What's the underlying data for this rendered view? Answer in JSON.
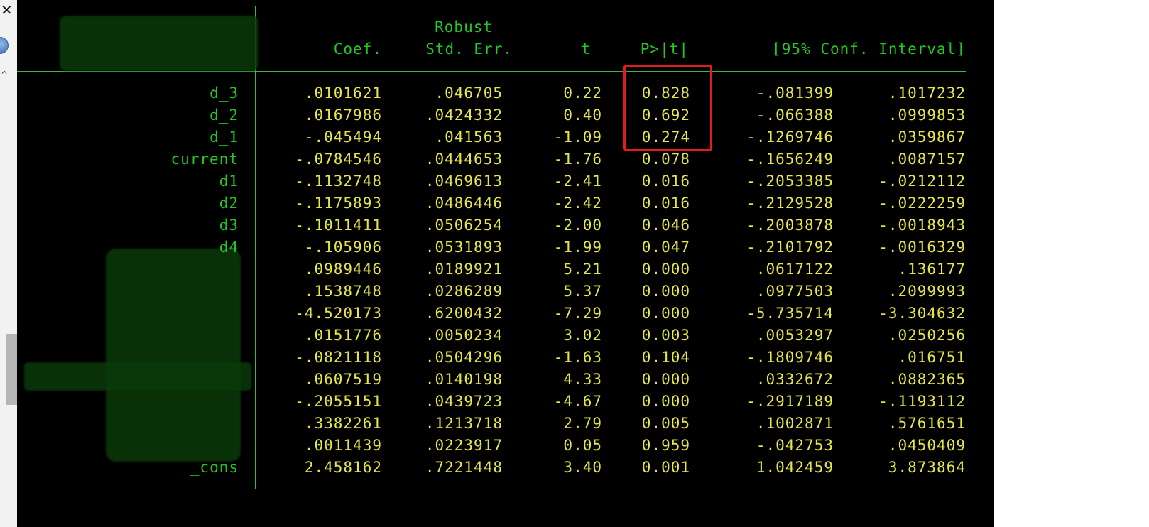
{
  "header": {
    "robust": "Robust",
    "coef": "Coef.",
    "stderr": "Std. Err.",
    "t": "t",
    "p": "P>|t|",
    "ci": "[95% Conf. Interval]"
  },
  "rows": [
    {
      "label": "d_3",
      "coef": ".0101621",
      "se": ".046705",
      "t": "0.22",
      "p": "0.828",
      "lo": "-.081399",
      "hi": ".1017232"
    },
    {
      "label": "d_2",
      "coef": ".0167986",
      "se": ".0424332",
      "t": "0.40",
      "p": "0.692",
      "lo": "-.066388",
      "hi": ".0999853"
    },
    {
      "label": "d_1",
      "coef": "-.045494",
      "se": ".041563",
      "t": "-1.09",
      "p": "0.274",
      "lo": "-.1269746",
      "hi": ".0359867"
    },
    {
      "label": "current",
      "coef": "-.0784546",
      "se": ".0444653",
      "t": "-1.76",
      "p": "0.078",
      "lo": "-.1656249",
      "hi": ".0087157"
    },
    {
      "label": "d1",
      "coef": "-.1132748",
      "se": ".0469613",
      "t": "-2.41",
      "p": "0.016",
      "lo": "-.2053385",
      "hi": "-.0212112"
    },
    {
      "label": "d2",
      "coef": "-.1175893",
      "se": ".0486446",
      "t": "-2.42",
      "p": "0.016",
      "lo": "-.2129528",
      "hi": "-.0222259"
    },
    {
      "label": "d3",
      "coef": "-.1011411",
      "se": ".0506254",
      "t": "-2.00",
      "p": "0.046",
      "lo": "-.2003878",
      "hi": "-.0018943"
    },
    {
      "label": "d4",
      "coef": "-.105906",
      "se": ".0531893",
      "t": "-1.99",
      "p": "0.047",
      "lo": "-.2101792",
      "hi": "-.0016329"
    },
    {
      "label": "",
      "coef": ".0989446",
      "se": ".0189921",
      "t": "5.21",
      "p": "0.000",
      "lo": ".0617122",
      "hi": ".136177"
    },
    {
      "label": "",
      "coef": ".1538748",
      "se": ".0286289",
      "t": "5.37",
      "p": "0.000",
      "lo": ".0977503",
      "hi": ".2099993"
    },
    {
      "label": "",
      "coef": "-4.520173",
      "se": ".6200432",
      "t": "-7.29",
      "p": "0.000",
      "lo": "-5.735714",
      "hi": "-3.304632"
    },
    {
      "label": "",
      "coef": ".0151776",
      "se": ".0050234",
      "t": "3.02",
      "p": "0.003",
      "lo": ".0053297",
      "hi": ".0250256"
    },
    {
      "label": "",
      "coef": "-.0821118",
      "se": ".0504296",
      "t": "-1.63",
      "p": "0.104",
      "lo": "-.1809746",
      "hi": ".016751"
    },
    {
      "label": "",
      "coef": ".0607519",
      "se": ".0140198",
      "t": "4.33",
      "p": "0.000",
      "lo": ".0332672",
      "hi": ".0882365"
    },
    {
      "label": "",
      "coef": "-.2055151",
      "se": ".0439723",
      "t": "-4.67",
      "p": "0.000",
      "lo": "-.2917189",
      "hi": "-.1193112"
    },
    {
      "label": "",
      "coef": ".3382261",
      "se": ".1213718",
      "t": "2.79",
      "p": "0.005",
      "lo": ".1002871",
      "hi": ".5761651"
    },
    {
      "label": "",
      "coef": ".0011439",
      "se": ".0223917",
      "t": "0.05",
      "p": "0.959",
      "lo": "-.042753",
      "hi": ".0450409"
    },
    {
      "label": "_cons",
      "coef": "2.458162",
      "se": ".7221448",
      "t": "3.40",
      "p": "0.001",
      "lo": "1.042459",
      "hi": "3.873864"
    }
  ],
  "left_strip": {
    "close_glyph": "✕",
    "caret_glyph": "^"
  },
  "colors": {
    "background": "#000000",
    "text_green": "#22c722",
    "text_yellow": "#e6e64a",
    "rule_green": "#3fb53f",
    "highlight_red": "#e21b1b"
  }
}
